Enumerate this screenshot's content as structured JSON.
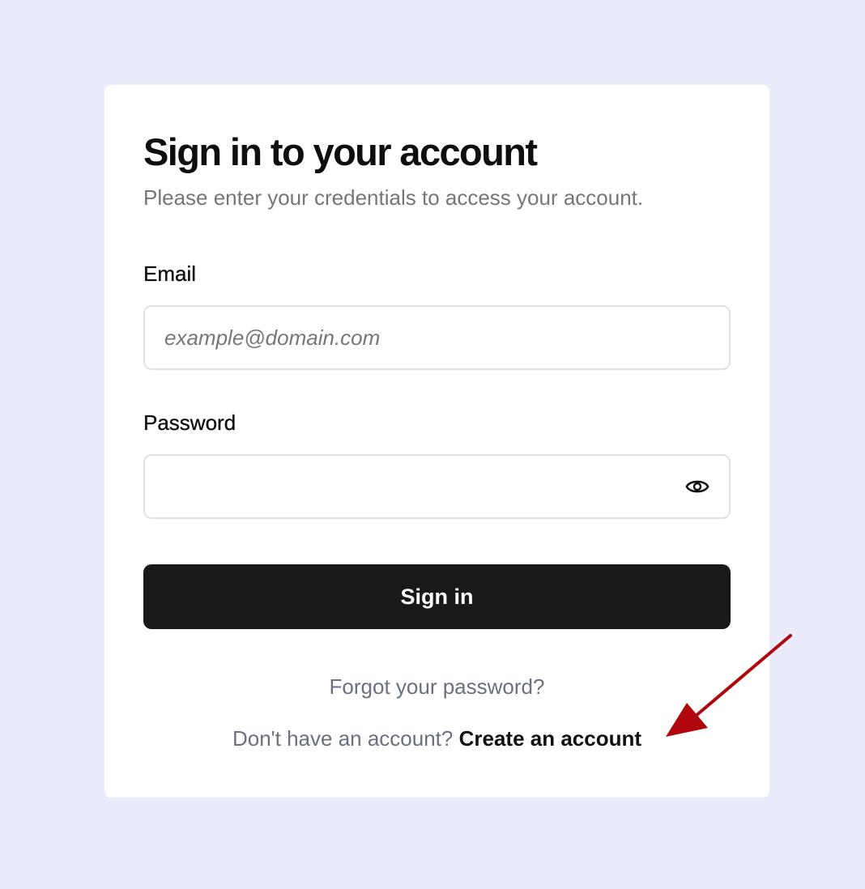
{
  "colors": {
    "page_background": "#ebecfb",
    "card_background": "#ffffff",
    "primary_button": "#191919",
    "muted_text": "#6b7080",
    "annotation_arrow": "#b0070d"
  },
  "form": {
    "title": "Sign in to your account",
    "subtitle": "Please enter your credentials to access your account.",
    "email": {
      "label": "Email",
      "placeholder": "example@domain.com",
      "value": ""
    },
    "password": {
      "label": "Password",
      "value": "",
      "toggle_icon": "eye-icon"
    },
    "submit_label": "Sign in",
    "forgot_label": "Forgot your password?",
    "signup_prompt": "Don't have an account?",
    "signup_link": "Create an account"
  },
  "annotation": {
    "icon": "arrow-icon",
    "target": "Create an account"
  }
}
